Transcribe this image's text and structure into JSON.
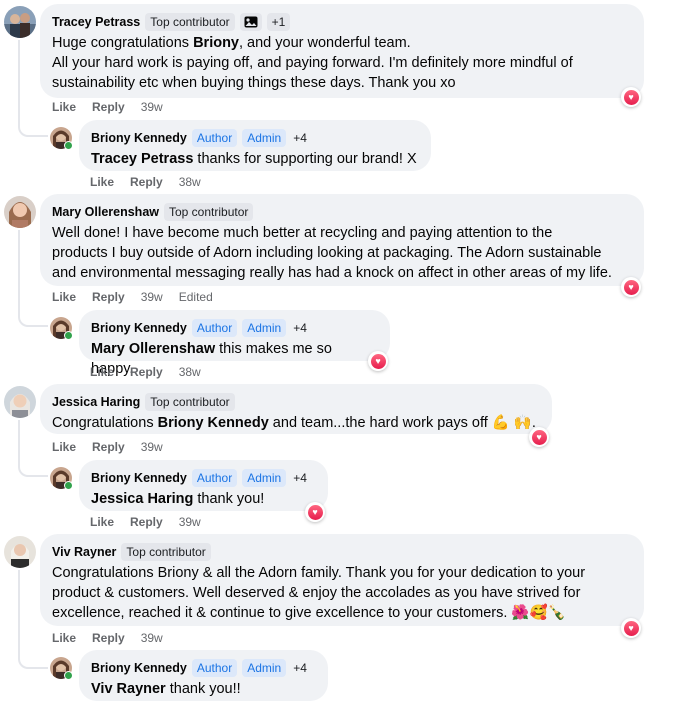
{
  "colors": {
    "bubble": "#f0f2f5",
    "badge": "#e4e6eb",
    "author_badge_text": "#1b74e4",
    "love_reaction": "#e61e4d",
    "online": "#31a24c"
  },
  "reaction_icon": "heart-icon",
  "comments": [
    {
      "name": "Tracey Petrass",
      "badge": "Top contributor",
      "extra_badge_icon": "image-icon",
      "extra_count": "+1",
      "text_lines": [
        [
          "Huge congratulations ",
          "Briony",
          ", and your wonderful team."
        ],
        [
          "All your hard work is paying off, and paying forward. I'm definitely more mindful of"
        ],
        [
          "sustainability etc when buying things these days. Thank you xo"
        ]
      ],
      "like": "Like",
      "reply_label": "Reply",
      "time": "39w",
      "edited": "",
      "reply": {
        "name": "Briony Kennedy",
        "badge_author": "Author",
        "badge_admin": "Admin",
        "extra_count": "+4",
        "mention": "Tracey Petrass",
        "text": " thanks for supporting our brand! X",
        "like": "Like",
        "reply_label": "Reply",
        "time": "38w"
      }
    },
    {
      "name": "Mary Ollerenshaw",
      "badge": "Top contributor",
      "text_lines": [
        [
          "Well done! I have become much better at recycling and paying attention to the"
        ],
        [
          "products I buy outside of Adorn including looking at packaging. The Adorn sustainable"
        ],
        [
          "and environmental messaging really has had a knock on affect in other areas of my life."
        ]
      ],
      "like": "Like",
      "reply_label": "Reply",
      "time": "39w",
      "edited": "Edited",
      "reply": {
        "name": "Briony Kennedy",
        "badge_author": "Author",
        "badge_admin": "Admin",
        "extra_count": "+4",
        "mention": "Mary Ollerenshaw",
        "text": " this makes me so happy.",
        "like": "Like",
        "reply_label": "Reply",
        "time": "38w"
      }
    },
    {
      "name": "Jessica Haring",
      "badge": "Top contributor",
      "text_lines": [
        [
          "Congratulations ",
          "Briony Kennedy",
          " and team...the hard work pays off 💪 🙌."
        ]
      ],
      "like": "Like",
      "reply_label": "Reply",
      "time": "39w",
      "edited": "",
      "reply": {
        "name": "Briony Kennedy",
        "badge_author": "Author",
        "badge_admin": "Admin",
        "extra_count": "+4",
        "mention": "Jessica Haring",
        "text": " thank you!",
        "like": "Like",
        "reply_label": "Reply",
        "time": "39w"
      }
    },
    {
      "name": "Viv Rayner",
      "badge": "Top contributor",
      "text_lines": [
        [
          "Congratulations Briony & all the Adorn family. Thank you for your dedication to your"
        ],
        [
          "product & customers. Well deserved & enjoy the accolades as you have strived for"
        ],
        [
          "excellence, reached it & continue to give excellence to your customers. 🌺🥰🍾"
        ]
      ],
      "like": "Like",
      "reply_label": "Reply",
      "time": "39w",
      "edited": "",
      "reply": {
        "name": "Briony Kennedy",
        "badge_author": "Author",
        "badge_admin": "Admin",
        "extra_count": "+4",
        "mention": "Viv Rayner",
        "text": " thank you!!",
        "like": "",
        "reply_label": "",
        "time": ""
      }
    }
  ]
}
